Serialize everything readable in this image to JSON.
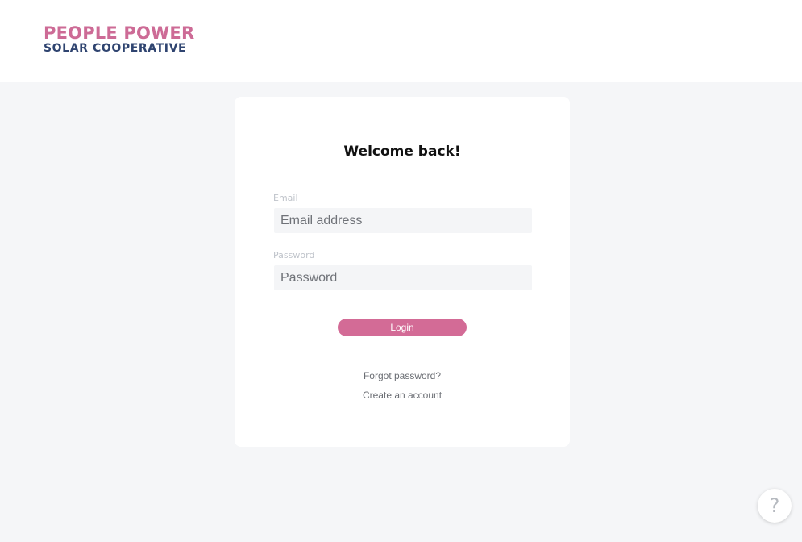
{
  "header": {
    "logo_line1": "PEOPLE POWER",
    "logo_line2": "SOLAR COOPERATIVE"
  },
  "login_card": {
    "title": "Welcome back!",
    "email": {
      "label": "Email",
      "placeholder": "Email address",
      "value": ""
    },
    "password": {
      "label": "Password",
      "placeholder": "Password",
      "value": ""
    },
    "login_label": "Login",
    "forgot_password_label": "Forgot password?",
    "create_account_label": "Create an account"
  },
  "help": {
    "label": "?"
  },
  "colors": {
    "brand_pink": "#d36b96",
    "brand_navy": "#2f4470",
    "page_background": "#f5f6f8"
  }
}
